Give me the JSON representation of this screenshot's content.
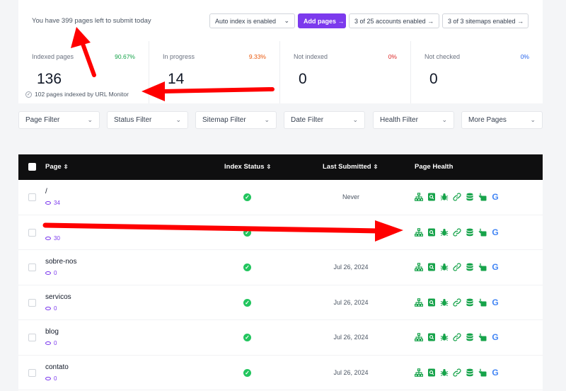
{
  "header": {
    "remaining_text": "You have 399 pages left to submit today",
    "auto_index_label": "Auto index is enabled",
    "add_pages_label": "Add pages →",
    "accounts_label": "3 of 25 accounts enabled →",
    "sitemaps_label": "3 of 3 sitemaps enabled →"
  },
  "stats": [
    {
      "label": "Indexed pages",
      "percent": "90.67%",
      "value": "136",
      "color": "#16a34a",
      "sub": "102 pages indexed by URL Monitor"
    },
    {
      "label": "In progress",
      "percent": "9.33%",
      "value": "14",
      "color": "#ea580c"
    },
    {
      "label": "Not indexed",
      "percent": "0%",
      "value": "0",
      "color": "#dc2626"
    },
    {
      "label": "Not checked",
      "percent": "0%",
      "value": "0",
      "color": "#2563eb"
    }
  ],
  "filters": [
    "Page Filter",
    "Status Filter",
    "Sitemap Filter",
    "Date Filter",
    "Health Filter",
    "More Pages"
  ],
  "table": {
    "columns": {
      "page": "Page",
      "index_status": "Index Status",
      "last_submitted": "Last Submitted",
      "page_health": "Page Health"
    },
    "rows": [
      {
        "page": "/",
        "views": "34",
        "status": "indexed",
        "date": "Never"
      },
      {
        "page": "",
        "views": "30",
        "status": "indexed",
        "date": ""
      },
      {
        "page": "sobre-nos",
        "views": "0",
        "status": "indexed",
        "date": "Jul 26, 2024"
      },
      {
        "page": "servicos",
        "views": "0",
        "status": "indexed",
        "date": "Jul 26, 2024"
      },
      {
        "page": "blog",
        "views": "0",
        "status": "indexed",
        "date": "Jul 26, 2024"
      },
      {
        "page": "contato",
        "views": "0",
        "status": "indexed",
        "date": "Jul 26, 2024"
      }
    ],
    "health_icons": [
      "sitemap-icon",
      "search-doc-icon",
      "bug-icon",
      "link-icon",
      "database-icon",
      "download-doc-icon",
      "google-icon"
    ]
  },
  "colors": {
    "accent": "#7c3aed",
    "success": "#22c55e",
    "health_green": "#16a34a",
    "annotation_red": "#ff0000"
  }
}
